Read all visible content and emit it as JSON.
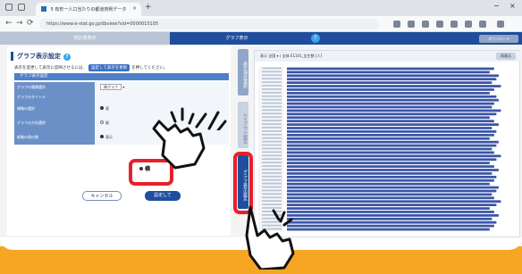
{
  "browser": {
    "tab_title": "5 有形一人口当たりの都道府県データ",
    "tab_close": "×",
    "new_tab": "+",
    "url": "https://www.e-stat.go.jp/dbview?sid=0000010105",
    "window_minimize": "−",
    "window_close": "×"
  },
  "header": {
    "left_tab": "統計表表示",
    "mid_tab": "グラフ表示",
    "help": "?",
    "right_button": "ダウンロード"
  },
  "settings": {
    "title": "グラフ表示設定",
    "help": "?",
    "note_before": "表示を変更して表示に反映させるには、",
    "note_chip": "設定して表示を更新",
    "note_after": "を押してください。",
    "section": "グラフ表示設定",
    "rows": [
      {
        "label": "グラフの種類選択",
        "value": "棒グラフ"
      },
      {
        "label": "グラフのタイトル",
        "value": ""
      },
      {
        "label": "横軸の選択",
        "value": "表"
      },
      {
        "label": "グラフの方向選択",
        "value": "横"
      },
      {
        "label": "縦軸の値の数",
        "value": "表示"
      }
    ],
    "orientation_option": "縦",
    "highlight_option": "横",
    "cancel_label": "キャンセル",
    "apply_label": "設定して"
  },
  "side_tabs": {
    "tab1": "表示項目選択",
    "tab2": "レイアウト設定",
    "tab3": "グラフ表示設定"
  },
  "chart_toolbar": {
    "text": "表示 全国 ▾  ⟨ 全体  E1101_出生数 [人]",
    "button": "再表示"
  },
  "chart_data": {
    "type": "bar",
    "orientation": "horizontal",
    "bar_color": "#3a55a8",
    "bar_count": 47,
    "values": [
      0.92,
      0.9,
      0.94,
      0.93,
      0.91,
      0.95,
      0.92,
      0.9,
      0.93,
      0.94,
      0.92,
      0.91,
      0.95,
      0.93,
      0.9,
      0.92,
      0.94,
      0.91,
      0.93,
      0.92,
      0.9,
      0.94,
      0.93,
      0.91,
      0.92,
      0.95,
      0.93,
      0.9,
      0.92,
      0.94,
      0.91,
      0.93,
      0.92,
      0.9,
      0.94,
      0.93,
      0.91,
      0.92,
      0.95,
      0.93,
      0.9,
      0.92,
      0.94,
      0.91,
      0.93,
      0.92,
      0.9
    ]
  }
}
